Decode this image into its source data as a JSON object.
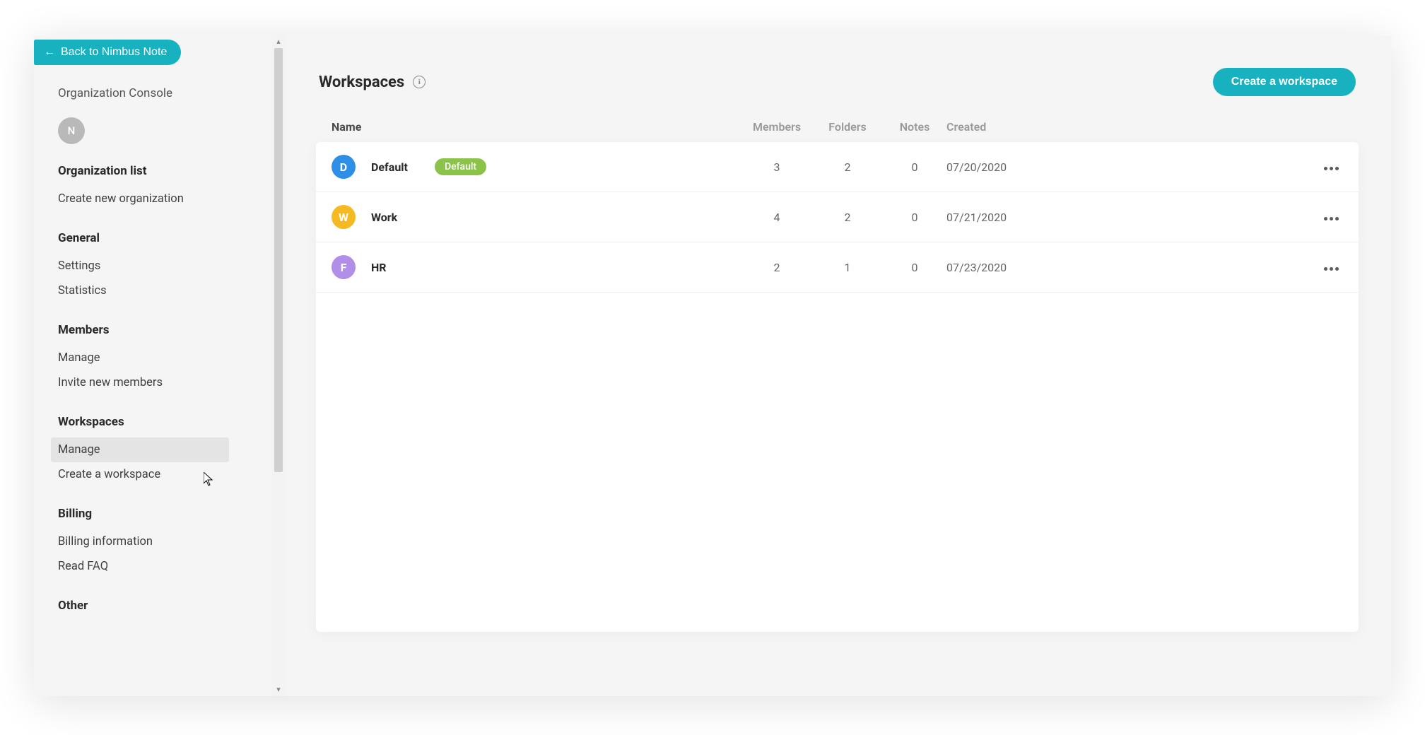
{
  "back_button": "Back to Nimbus Note",
  "org_console_title": "Organization Console",
  "avatar_letter": "N",
  "sidebar": {
    "groups": [
      {
        "heading": "Organization list",
        "items": [
          {
            "label": "Create new organization",
            "active": false
          }
        ]
      },
      {
        "heading": "General",
        "items": [
          {
            "label": "Settings",
            "active": false
          },
          {
            "label": "Statistics",
            "active": false
          }
        ]
      },
      {
        "heading": "Members",
        "items": [
          {
            "label": "Manage",
            "active": false
          },
          {
            "label": "Invite new members",
            "active": false
          }
        ]
      },
      {
        "heading": "Workspaces",
        "items": [
          {
            "label": "Manage",
            "active": true
          },
          {
            "label": "Create a workspace",
            "active": false
          }
        ]
      },
      {
        "heading": "Billing",
        "items": [
          {
            "label": "Billing information",
            "active": false
          },
          {
            "label": "Read FAQ",
            "active": false
          }
        ]
      },
      {
        "heading": "Other",
        "items": []
      }
    ]
  },
  "main": {
    "title": "Workspaces",
    "create_button": "Create a workspace",
    "columns": {
      "name": "Name",
      "members": "Members",
      "folders": "Folders",
      "notes": "Notes",
      "created": "Created"
    },
    "rows": [
      {
        "letter": "D",
        "name": "Default",
        "is_default": true,
        "color": "#2d8fe6",
        "members": "3",
        "folders": "2",
        "notes": "0",
        "created": "07/20/2020"
      },
      {
        "letter": "W",
        "name": "Work",
        "is_default": false,
        "color": "#f5b921",
        "members": "4",
        "folders": "2",
        "notes": "0",
        "created": "07/21/2020"
      },
      {
        "letter": "F",
        "name": "HR",
        "is_default": false,
        "color": "#b18ee8",
        "members": "2",
        "folders": "1",
        "notes": "0",
        "created": "07/23/2020"
      }
    ],
    "default_badge": "Default"
  }
}
